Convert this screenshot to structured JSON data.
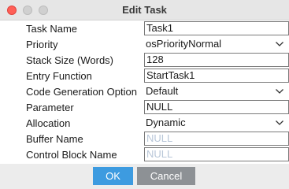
{
  "window": {
    "title": "Edit Task"
  },
  "fields": {
    "task_name": {
      "label": "Task Name",
      "value": "Task1"
    },
    "priority": {
      "label": "Priority",
      "value": "osPriorityNormal"
    },
    "stack_size": {
      "label": "Stack Size (Words)",
      "value": "128"
    },
    "entry_function": {
      "label": "Entry Function",
      "value": "StartTask1"
    },
    "code_generation": {
      "label": "Code Generation Option",
      "value": "Default"
    },
    "parameter": {
      "label": "Parameter",
      "value": "NULL"
    },
    "allocation": {
      "label": "Allocation",
      "value": "Dynamic"
    },
    "buffer_name": {
      "label": "Buffer Name",
      "placeholder": "NULL"
    },
    "control_block_name": {
      "label": "Control Block Name",
      "placeholder": "NULL"
    }
  },
  "buttons": {
    "ok": "OK",
    "cancel": "Cancel"
  },
  "colors": {
    "close_button": "#ff5f57",
    "ok_button": "#3d9be0",
    "cancel_button": "#8d9195",
    "placeholder_text": "#b8c6d8"
  }
}
